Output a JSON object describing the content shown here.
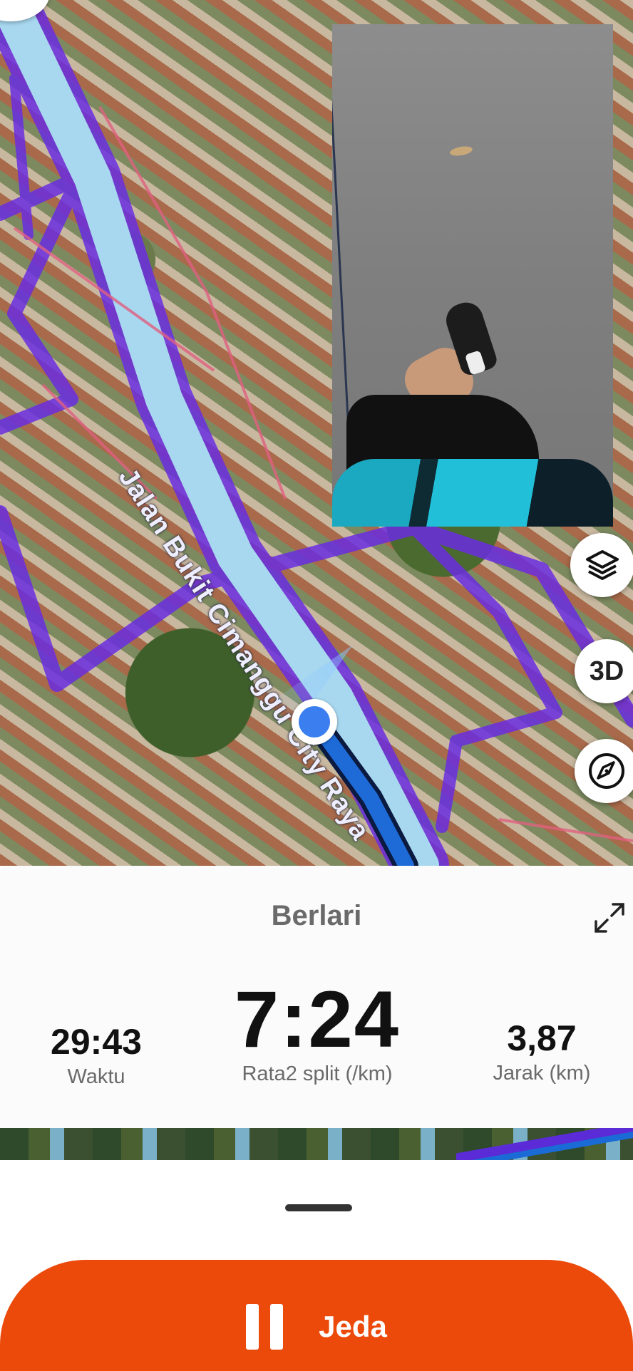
{
  "map": {
    "street_label": "Jalan Bukit Cimanggu City Raya",
    "controls": {
      "three_d_label": "3D"
    },
    "route_color": "#7a3cf0",
    "track_color": "#1e6bd8"
  },
  "panel": {
    "activity_type": "Berlari",
    "stats": {
      "time": {
        "value": "29:43",
        "label": "Waktu"
      },
      "pace": {
        "value": "7:24",
        "label": "Rata2 split (/km)"
      },
      "distance": {
        "value": "3,87",
        "label": "Jarak (km)"
      }
    }
  },
  "actions": {
    "pause_label": "Jeda",
    "pause_color": "#ec4a0a"
  }
}
